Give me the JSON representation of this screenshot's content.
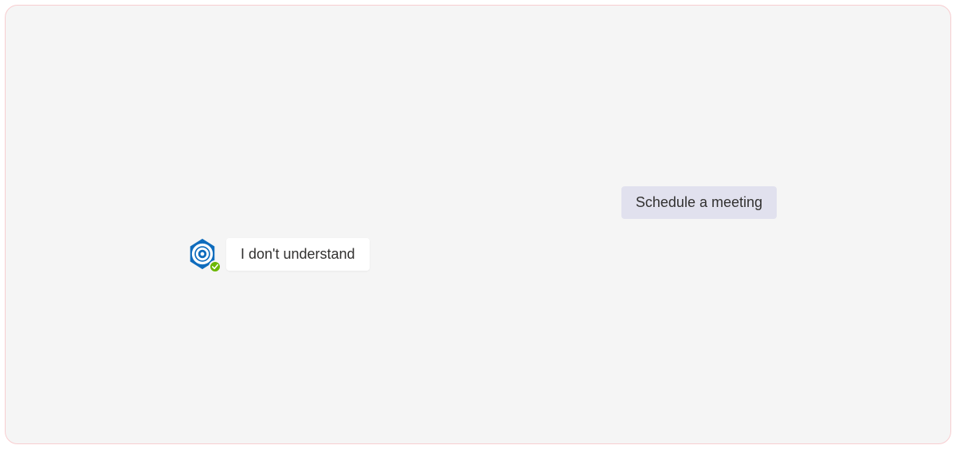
{
  "chat": {
    "user_message": "Schedule a meeting",
    "bot_message": "I don't understand"
  },
  "colors": {
    "container_bg": "#f5f5f5",
    "container_border": "#f8cdd0",
    "user_bubble_bg": "#e1e1ee",
    "bot_bubble_bg": "#ffffff",
    "bot_avatar_primary": "#0f6cbd",
    "presence_available": "#6bb700"
  }
}
